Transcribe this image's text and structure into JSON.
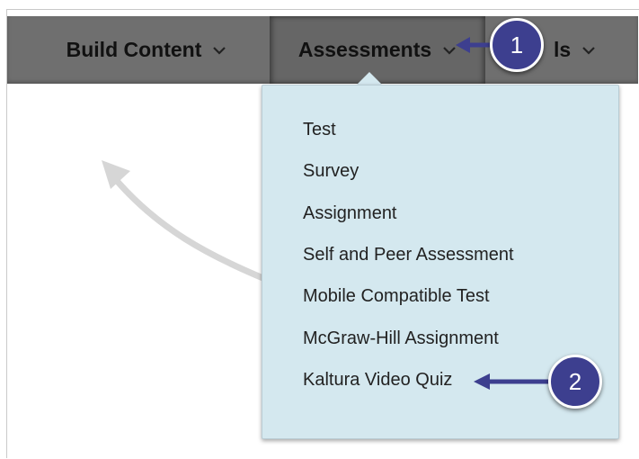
{
  "toolbar": {
    "build_content": "Build Content",
    "assessments": "Assessments",
    "tools_partial": "ls"
  },
  "menu": {
    "items": [
      "Test",
      "Survey",
      "Assignment",
      "Self and Peer Assessment",
      "Mobile Compatible Test",
      "McGraw-Hill Assignment",
      "Kaltura Video Quiz"
    ]
  },
  "callouts": {
    "step1": "1",
    "step2": "2"
  },
  "colors": {
    "toolbar": "#6f6f6f",
    "menu_bg": "#d4e8ef",
    "callout": "#3d3f8f"
  }
}
